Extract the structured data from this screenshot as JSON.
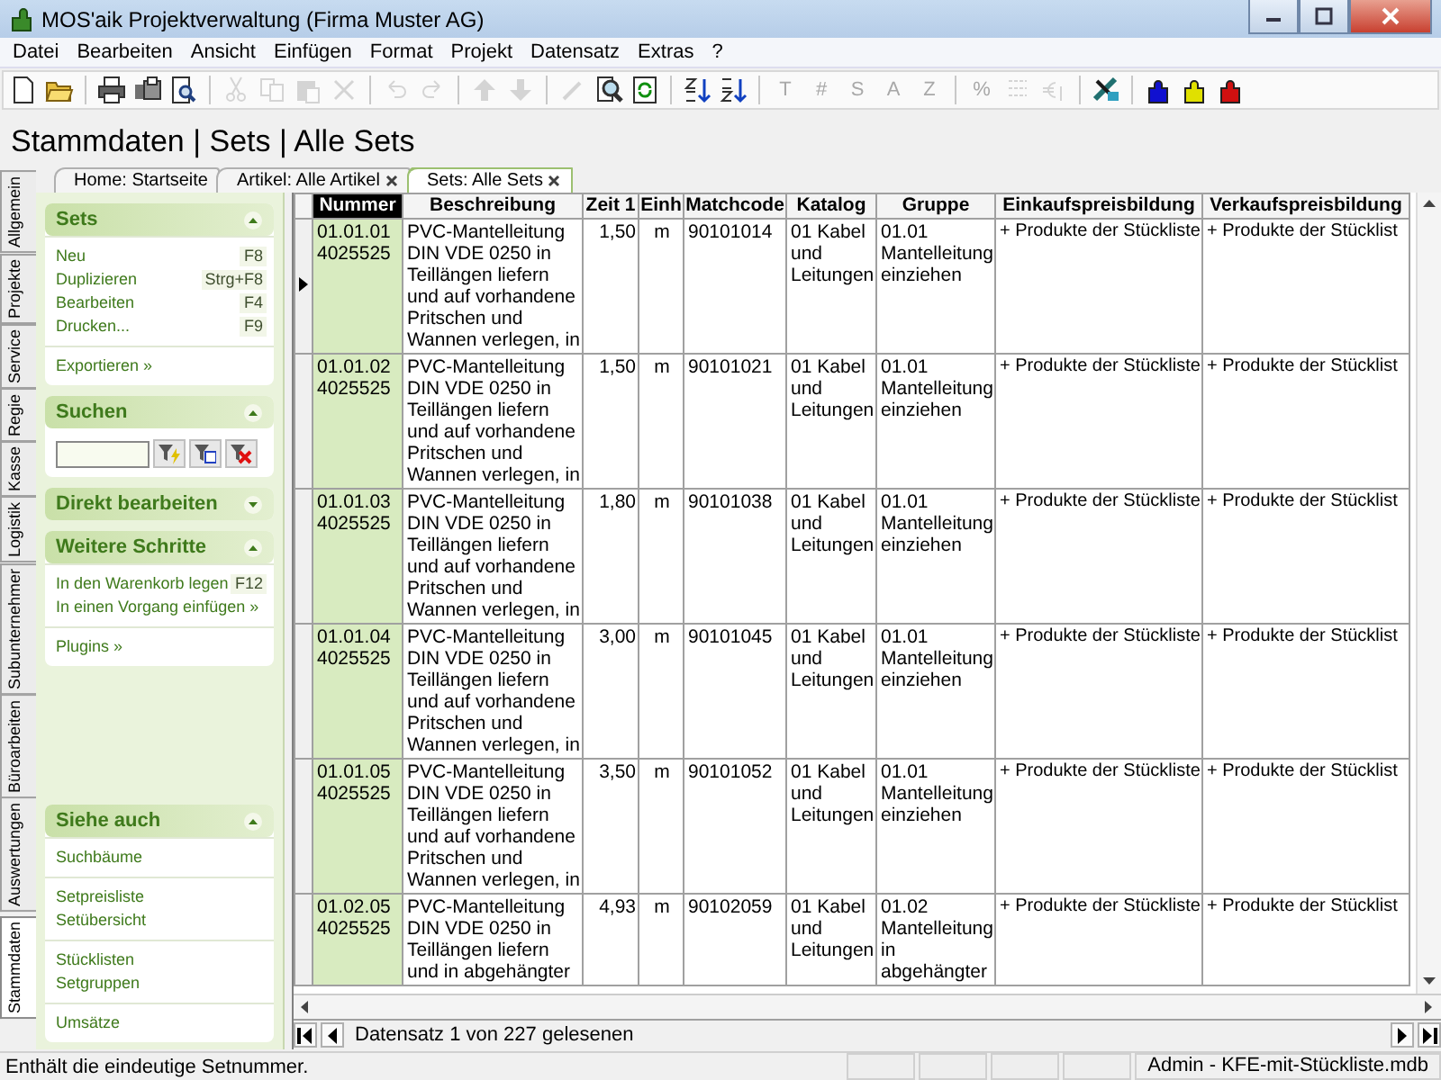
{
  "window": {
    "title": "MOS'aik Projektverwaltung (Firma Muster AG)"
  },
  "menu": [
    {
      "label": "Datei"
    },
    {
      "label": "Bearbeiten"
    },
    {
      "label": "Ansicht"
    },
    {
      "label": "Einfügen"
    },
    {
      "label": "Format"
    },
    {
      "label": "Projekt"
    },
    {
      "label": "Datensatz"
    },
    {
      "label": "Extras"
    },
    {
      "label": "?"
    }
  ],
  "toolbar": [
    {
      "kind": "new",
      "disabled": false
    },
    {
      "kind": "open",
      "disabled": false
    },
    {
      "kind": "separator"
    },
    {
      "kind": "print",
      "disabled": false
    },
    {
      "kind": "printall",
      "disabled": false
    },
    {
      "kind": "preview",
      "disabled": false
    },
    {
      "kind": "separator"
    },
    {
      "kind": "cut",
      "disabled": true
    },
    {
      "kind": "copy",
      "disabled": true
    },
    {
      "kind": "paste",
      "disabled": true
    },
    {
      "kind": "delete",
      "disabled": true
    },
    {
      "kind": "separator"
    },
    {
      "kind": "undo",
      "disabled": true
    },
    {
      "kind": "redo",
      "disabled": true
    },
    {
      "kind": "separator"
    },
    {
      "kind": "up",
      "disabled": true
    },
    {
      "kind": "down",
      "disabled": true
    },
    {
      "kind": "separator"
    },
    {
      "kind": "pen",
      "disabled": true
    },
    {
      "kind": "find",
      "disabled": false
    },
    {
      "kind": "refresh",
      "disabled": false
    },
    {
      "kind": "separator"
    },
    {
      "kind": "sortup",
      "disabled": false
    },
    {
      "kind": "sortdown",
      "disabled": false
    },
    {
      "kind": "separator"
    },
    {
      "kind": "glyph",
      "text": "T",
      "disabled": true
    },
    {
      "kind": "glyph",
      "text": "#",
      "disabled": true
    },
    {
      "kind": "glyph",
      "text": "S",
      "disabled": true
    },
    {
      "kind": "glyph",
      "text": "A",
      "disabled": true
    },
    {
      "kind": "glyph",
      "text": "Z",
      "disabled": true
    },
    {
      "kind": "separator"
    },
    {
      "kind": "glyph",
      "text": "%",
      "disabled": true
    },
    {
      "kind": "numbering",
      "disabled": true
    },
    {
      "kind": "currency",
      "disabled": true
    },
    {
      "kind": "separator"
    },
    {
      "kind": "tools",
      "disabled": false
    },
    {
      "kind": "separator"
    },
    {
      "kind": "puzzle",
      "color": "#1010d0",
      "disabled": false
    },
    {
      "kind": "puzzle",
      "color": "#e0e000",
      "disabled": false
    },
    {
      "kind": "puzzle",
      "color": "#d01010",
      "disabled": false
    }
  ],
  "heading": "Stammdaten | Sets | Alle Sets",
  "doc_tabs": [
    {
      "label": "Home: Startseite",
      "closable": false,
      "selected": false
    },
    {
      "label": "Artikel: Alle Artikel",
      "closable": true,
      "selected": false
    },
    {
      "label": "Sets: Alle Sets",
      "closable": true,
      "selected": true
    }
  ],
  "side_tabs": [
    {
      "label": "Allgemein",
      "selected": false
    },
    {
      "label": "Projekte",
      "selected": false
    },
    {
      "label": "Service",
      "selected": false
    },
    {
      "label": "Regie",
      "selected": false
    },
    {
      "label": "Kasse",
      "selected": false
    },
    {
      "label": "Logistik",
      "selected": false
    },
    {
      "label": "Subunternehmer",
      "selected": false
    },
    {
      "label": "Büroarbeiten",
      "selected": false
    },
    {
      "label": "Auswertungen",
      "selected": false
    },
    {
      "label": "Stammdaten",
      "selected": true
    }
  ],
  "panel": {
    "sections": [
      {
        "kind": "links",
        "title": "Sets",
        "expanded": true,
        "groups": [
          [
            {
              "label": "Neu",
              "shortcut": "F8"
            },
            {
              "label": "Duplizieren",
              "shortcut": "Strg+F8"
            },
            {
              "label": "Bearbeiten",
              "shortcut": "F4"
            },
            {
              "label": "Drucken...",
              "shortcut": "F9"
            }
          ],
          [
            {
              "label": "Exportieren »"
            }
          ]
        ]
      },
      {
        "kind": "search",
        "title": "Suchen",
        "expanded": true
      },
      {
        "kind": "links",
        "title": "Direkt bearbeiten",
        "expanded": false
      },
      {
        "kind": "links",
        "title": "Weitere Schritte",
        "expanded": true,
        "groups": [
          [
            {
              "label": "In den Warenkorb legen",
              "shortcut": "F12"
            },
            {
              "label": "In einen Vorgang einfügen »"
            }
          ],
          [
            {
              "label": "Plugins »"
            }
          ]
        ]
      },
      {
        "kind": "spacer"
      },
      {
        "kind": "links",
        "title": "Siehe auch",
        "expanded": true,
        "groups": [
          [
            {
              "label": "Suchbäume"
            }
          ],
          [
            {
              "label": "Setpreisliste"
            },
            {
              "label": "Setübersicht"
            }
          ],
          [
            {
              "label": "Stücklisten"
            },
            {
              "label": "Setgruppen"
            }
          ],
          [
            {
              "label": "Umsätze"
            }
          ]
        ]
      }
    ]
  },
  "grid": {
    "columns": [
      {
        "label": "Nummer",
        "selected": true
      },
      {
        "label": "Beschreibung",
        "selected": false
      },
      {
        "label": "Zeit 1",
        "selected": false
      },
      {
        "label": "Einh",
        "selected": false
      },
      {
        "label": "Matchcode",
        "selected": false
      },
      {
        "label": "Katalog",
        "selected": false
      },
      {
        "label": "Gruppe",
        "selected": false
      },
      {
        "label": "Einkaufspreisbildung",
        "selected": false
      },
      {
        "label": "Verkaufspreisbildung",
        "selected": false
      }
    ],
    "rows": [
      {
        "selected": true,
        "cells": [
          "01.01.01 4025525",
          "PVC-Mantelleitung DIN VDE 0250 in Teillängen liefern und auf vorhandene Pritschen und Wannen verlegen, in",
          "1,50",
          "m",
          "90101014",
          "01 Kabel und Leitungen",
          "01.01 Mantelleitung einziehen",
          "+ Produkte der Stückliste",
          "+ Produkte der Stücklist"
        ]
      },
      {
        "selected": false,
        "cells": [
          "01.01.02 4025525",
          "PVC-Mantelleitung DIN VDE 0250 in Teillängen liefern und auf vorhandene Pritschen und Wannen verlegen, in",
          "1,50",
          "m",
          "90101021",
          "01 Kabel und Leitungen",
          "01.01 Mantelleitung einziehen",
          "+ Produkte der Stückliste",
          "+ Produkte der Stücklist"
        ]
      },
      {
        "selected": false,
        "cells": [
          "01.01.03 4025525",
          "PVC-Mantelleitung DIN VDE 0250 in Teillängen liefern und auf vorhandene Pritschen und Wannen verlegen, in",
          "1,80",
          "m",
          "90101038",
          "01 Kabel und Leitungen",
          "01.01 Mantelleitung einziehen",
          "+ Produkte der Stückliste",
          "+ Produkte der Stücklist"
        ]
      },
      {
        "selected": false,
        "cells": [
          "01.01.04 4025525",
          "PVC-Mantelleitung DIN VDE 0250 in Teillängen liefern und auf vorhandene Pritschen und Wannen verlegen, in",
          "3,00",
          "m",
          "90101045",
          "01 Kabel und Leitungen",
          "01.01 Mantelleitung einziehen",
          "+ Produkte der Stückliste",
          "+ Produkte der Stücklist"
        ]
      },
      {
        "selected": false,
        "cells": [
          "01.01.05 4025525",
          "PVC-Mantelleitung DIN VDE 0250 in Teillängen liefern und auf vorhandene Pritschen und Wannen verlegen, in",
          "3,50",
          "m",
          "90101052",
          "01 Kabel und Leitungen",
          "01.01 Mantelleitung einziehen",
          "+ Produkte der Stückliste",
          "+ Produkte der Stücklist"
        ]
      },
      {
        "selected": false,
        "cells": [
          "01.02.05 4025525",
          "PVC-Mantelleitung DIN VDE 0250 in Teillängen liefern und in abgehängter",
          "4,93",
          "m",
          "90102059",
          "01 Kabel und Leitungen",
          "01.02 Mantelleitung in abgehängter",
          "+ Produkte der Stückliste",
          "+ Produkte der Stücklist"
        ]
      }
    ]
  },
  "navigator": {
    "text": "Datensatz 1 von 227 gelesenen"
  },
  "status_bar": {
    "message": "Enthält die eindeutige Setnummer.",
    "right": "Admin - KFE-mit-Stückliste.mdb"
  }
}
